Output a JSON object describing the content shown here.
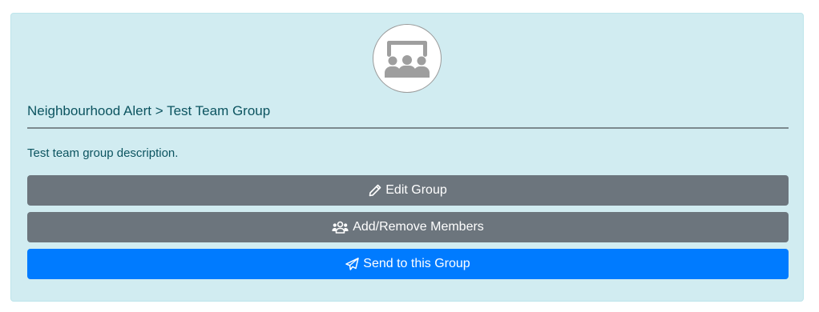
{
  "group": {
    "avatar_icon": "chalkboard-teacher-icon",
    "breadcrumb": "Neighbourhood Alert > Test Team Group",
    "description": "Test team group description."
  },
  "actions": {
    "edit": {
      "label": "Edit Group",
      "icon": "pencil-icon"
    },
    "members": {
      "label": "Add/Remove Members",
      "icon": "users-icon"
    },
    "send": {
      "label": "Send to this Group",
      "icon": "paper-plane-icon"
    }
  },
  "colors": {
    "card_background": "#d1ecf1",
    "card_text": "#0c5460",
    "secondary_button": "#6c757d",
    "primary_button": "#007bff",
    "avatar_icon": "#9e9e9e"
  }
}
